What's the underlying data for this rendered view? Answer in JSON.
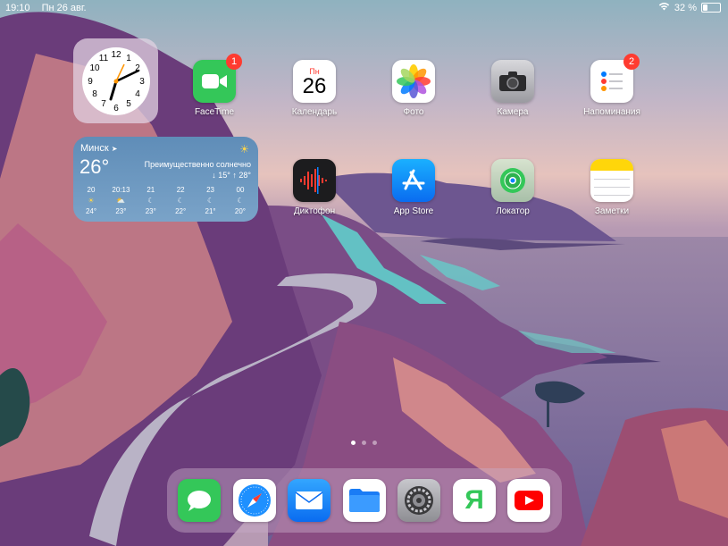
{
  "status": {
    "time": "19:10",
    "date": "Пн 26 авг.",
    "battery": "32 %",
    "battery_level": 0.32
  },
  "widgets": {
    "weather": {
      "city": "Минск",
      "temp": "26°",
      "condition": "Преимущественно солнечно",
      "hilo": "↓ 15° ↑ 28°",
      "forecast": [
        {
          "time": "20",
          "icon": "sun-icon",
          "temp": "24°"
        },
        {
          "time": "20:13",
          "icon": "sunset-icon",
          "temp": "23°"
        },
        {
          "time": "21",
          "icon": "moon-icon",
          "temp": "23°"
        },
        {
          "time": "22",
          "icon": "moon-icon",
          "temp": "22°"
        },
        {
          "time": "23",
          "icon": "moon-icon",
          "temp": "21°"
        },
        {
          "time": "00",
          "icon": "moon-icon",
          "temp": "20°"
        }
      ]
    }
  },
  "apps": {
    "facetime": {
      "label": "FaceTime",
      "badge": "1"
    },
    "calendar": {
      "label": "Календарь",
      "day_name": "Пн",
      "day_number": "26"
    },
    "photos": {
      "label": "Фото"
    },
    "camera": {
      "label": "Камера"
    },
    "reminders": {
      "label": "Напоминания",
      "badge": "2"
    },
    "voice_memos": {
      "label": "Диктофон"
    },
    "app_store": {
      "label": "App Store"
    },
    "find_my": {
      "label": "Локатор"
    },
    "notes": {
      "label": "Заметки"
    }
  },
  "dock": {
    "yandex_glyph": "Я"
  },
  "colors": {
    "facetime": "#34c759",
    "badge": "#ff3b30",
    "app_store": "#1a8cff",
    "messages": "#34c759",
    "mail": "#1e90ff",
    "files": "#1a7cf5",
    "youtube": "#ff0000"
  }
}
